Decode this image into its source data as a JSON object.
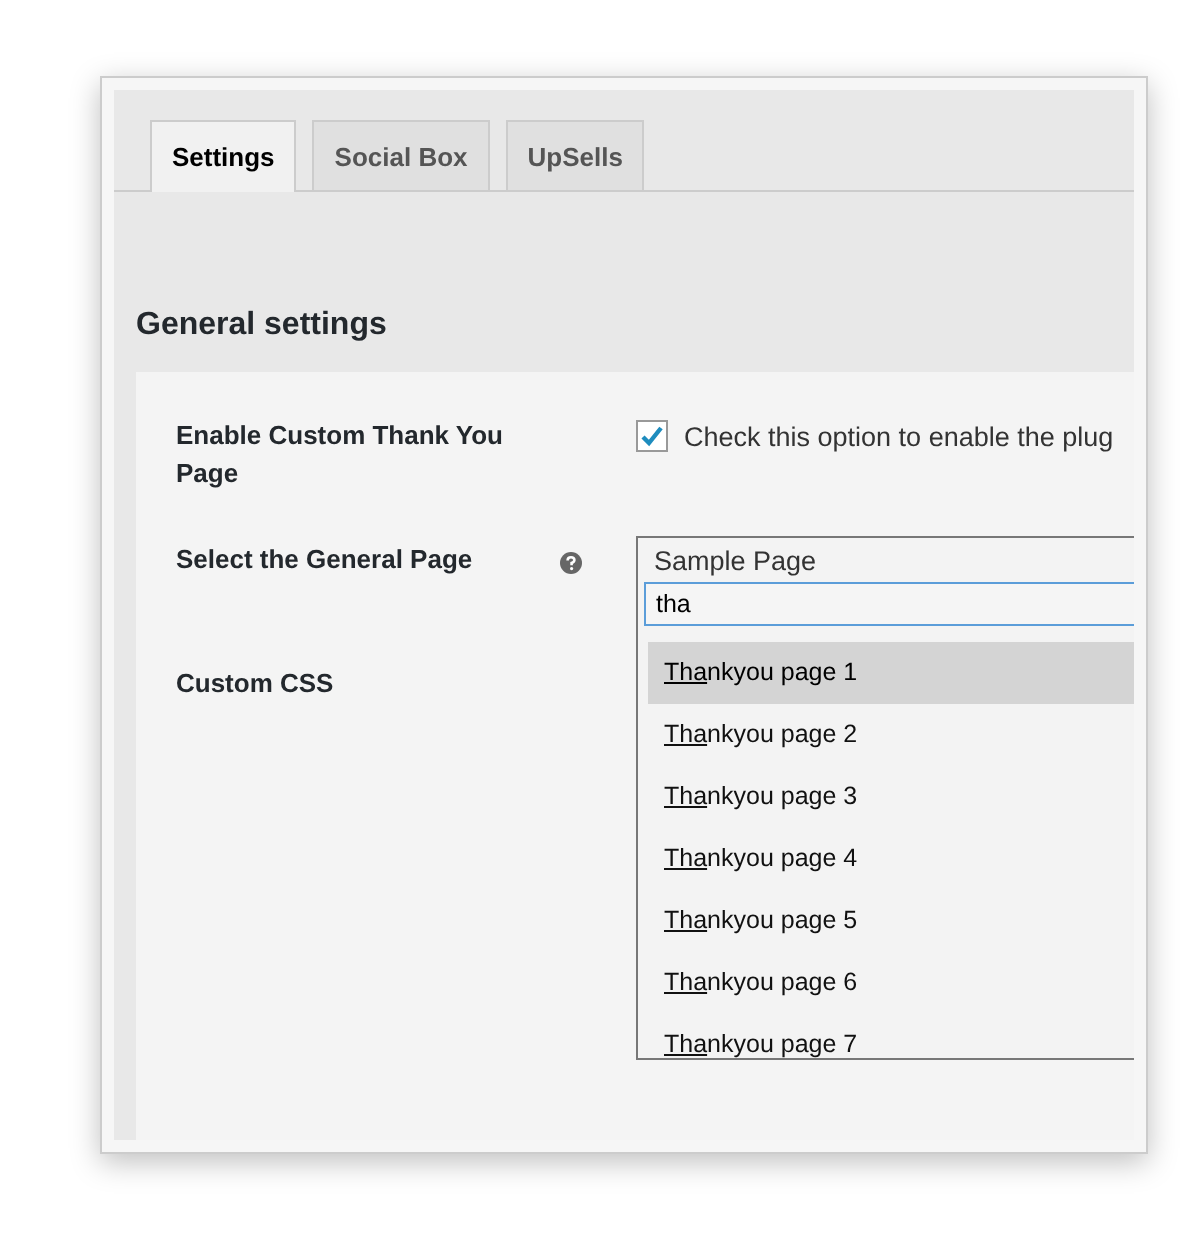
{
  "tabs": [
    {
      "label": "Settings",
      "selected": true
    },
    {
      "label": "Social Box",
      "selected": false
    },
    {
      "label": "UpSells",
      "selected": false
    }
  ],
  "section_title": "General settings",
  "fields": [
    {
      "kind": "checkbox",
      "label": "Enable Custom Thank You Page",
      "checked": true,
      "text": "Check this option to enable the plug"
    },
    {
      "kind": "select",
      "label": "Select the General Page",
      "help": true,
      "value": "Sample Page",
      "search": "tha",
      "options": [
        {
          "match": "Tha",
          "rest": "nkyou page 1",
          "selected": true
        },
        {
          "match": "Tha",
          "rest": "nkyou page 2",
          "selected": false
        },
        {
          "match": "Tha",
          "rest": "nkyou page 3",
          "selected": false
        },
        {
          "match": "Tha",
          "rest": "nkyou page 4",
          "selected": false
        },
        {
          "match": "Tha",
          "rest": "nkyou page 5",
          "selected": false
        },
        {
          "match": "Tha",
          "rest": "nkyou page 6",
          "selected": false
        },
        {
          "match": "Tha",
          "rest": "nkyou page 7",
          "selected": false
        }
      ]
    },
    {
      "kind": "label",
      "label": "Custom CSS"
    }
  ]
}
